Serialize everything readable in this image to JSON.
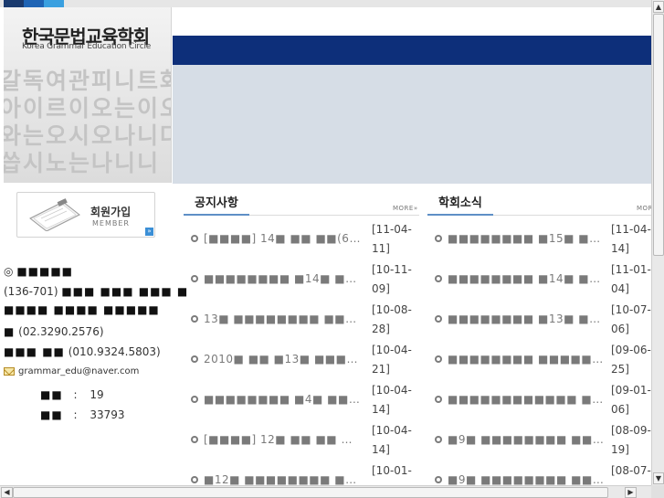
{
  "colors": {
    "navy": "#0d2f7a",
    "tab_dark": "#1a3a6e",
    "tab_mid": "#1f64b5",
    "tab_light": "#3aa0e0",
    "header_gray": "#d6dde6",
    "accent_line": "#5e8fc6"
  },
  "header": {
    "logo_ko": "한국문법교육학회",
    "logo_en": "Korea Grammar Education Circle",
    "bg_hangul": "갈독여관피니트화아이르이오는이오와는오시오나니다씁시노는나니니"
  },
  "sidebar": {
    "member_label_ko": "회원가입",
    "member_label_en": "MEMBER",
    "member_arrow": "»",
    "addr_bullet": "◎",
    "addr_head": "■■■■■",
    "addr_line1_zip": "(136-701)",
    "addr_line1_rest": "■■■ ■■■ ■■■ ■",
    "addr_line2": "■■■■ ■■■■ ■■■■■",
    "tel_label": "■",
    "tel": "(02.3290.2576)",
    "mobile_label": "■■■ ■■",
    "mobile": "(010.9324.5803)",
    "email": "grammar_edu@naver.com",
    "today_label": "■■",
    "today_sep": ":",
    "today_value": "19",
    "total_label": "■■",
    "total_sep": ":",
    "total_value": "33793"
  },
  "notice": {
    "tab": "공지사항",
    "more": "MORE»",
    "items": [
      {
        "title": "[■■■■] 14■ ■■ ■■(6■ ...",
        "date": "[11-04-11]"
      },
      {
        "title": "■■■■■■■■ ■14■ ■■■...",
        "date": "[10-11-09]"
      },
      {
        "title": "13■ ■■■■■■■■ ■■■ ■■...",
        "date": "[10-08-28]"
      },
      {
        "title": "2010■ ■■ ■13■ ■■■■ ■■...",
        "date": "[10-04-21]"
      },
      {
        "title": "■■■■■■■■ ■4■ ■■■ ...",
        "date": "[10-04-14]"
      },
      {
        "title": "[■■■■] 12■ ■■ ■■ ■■",
        "date": "[10-04-14]"
      },
      {
        "title": "■12■ ■■■■■■■■ ■■■...",
        "date": "[10-01-"
      }
    ]
  },
  "news": {
    "tab": "학회소식",
    "more": "MORE",
    "items": [
      {
        "title": "■■■■■■■■ ■15■ ■■■...",
        "date": "[11-04-14]"
      },
      {
        "title": "■■■■■■■■ ■14■ ■■■...",
        "date": "[11-01-04]"
      },
      {
        "title": "■■■■■■■■ ■13■ ■■■...",
        "date": "[10-07-06]"
      },
      {
        "title": "■■■■■■■■ ■■■■■■■■...",
        "date": "[09-06-25]"
      },
      {
        "title": "■■■■■■■■■■■■ ■■■...",
        "date": "[09-01-06]"
      },
      {
        "title": "■9■ ■■■■■■■■ ■■■■...",
        "date": "[08-09-19]"
      },
      {
        "title": "■9■ ■■■■■■■■ ■■■■...",
        "date": "[08-07-"
      }
    ]
  },
  "scrollbars": {
    "up": "▲",
    "down": "▼",
    "left": "◀",
    "right": "▶"
  }
}
